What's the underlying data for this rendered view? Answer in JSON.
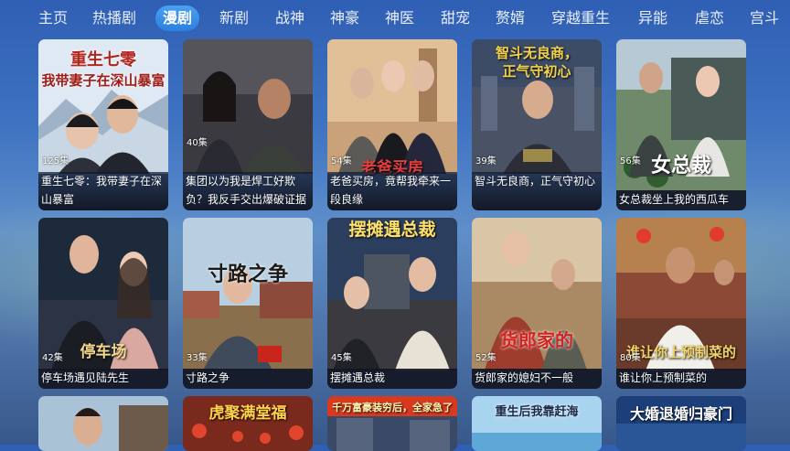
{
  "nav": {
    "tabs": [
      {
        "label": "主页",
        "active": false
      },
      {
        "label": "热播剧",
        "active": false
      },
      {
        "label": "漫剧",
        "active": true
      },
      {
        "label": "新剧",
        "active": false
      },
      {
        "label": "战神",
        "active": false
      },
      {
        "label": "神豪",
        "active": false
      },
      {
        "label": "神医",
        "active": false
      },
      {
        "label": "甜宠",
        "active": false
      },
      {
        "label": "赘婿",
        "active": false
      },
      {
        "label": "穿越重生",
        "active": false
      },
      {
        "label": "异能",
        "active": false
      },
      {
        "label": "虐恋",
        "active": false
      },
      {
        "label": "宫斗",
        "active": false
      }
    ]
  },
  "cards": [
    {
      "episodes": "125集",
      "title": "重生七零：我带妻子在深山暴富",
      "poster_text": "重生七零 我带妻子在深山暴富"
    },
    {
      "episodes": "40集",
      "title": "集团以为我是焊工好欺负？我反手交出爆破证据",
      "poster_text": "集团以为我是焊工好欺负?"
    },
    {
      "episodes": "54集",
      "title": "老爸买房，竟帮我牵来一段良缘",
      "poster_text": "老爸买房"
    },
    {
      "episodes": "39集",
      "title": "智斗无良商，正气守初心",
      "poster_text": "智斗无良商，正气守初心"
    },
    {
      "episodes": "56集",
      "title": "女总裁坐上我的西瓜车",
      "poster_text": "女总裁 坐上我的"
    },
    {
      "episodes": "42集",
      "title": "停车场遇见陆先生",
      "poster_text": "停车场 遇见陆先生"
    },
    {
      "episodes": "33集",
      "title": "寸路之争",
      "poster_text": "寸路之争"
    },
    {
      "episodes": "45集",
      "title": "摆摊遇总裁",
      "poster_text": "摆摊遇总裁"
    },
    {
      "episodes": "52集",
      "title": "货郎家的媳妇不一般",
      "poster_text": "货郎家的 媳妇不一般"
    },
    {
      "episodes": "80集",
      "title": "谁让你上预制菜的",
      "poster_text": "谁让你上预制菜的"
    },
    {
      "episodes": "",
      "title": "",
      "poster_text": ""
    },
    {
      "episodes": "",
      "title": "",
      "poster_text": "虎聚满堂福"
    },
    {
      "episodes": "",
      "title": "",
      "poster_text": "千万富豪装穷后，全家急了"
    },
    {
      "episodes": "",
      "title": "",
      "poster_text": "重生后我靠赶海 逆袭人生"
    },
    {
      "episodes": "",
      "title": "",
      "poster_text": "大婚退婚归豪门"
    }
  ],
  "colors": {
    "active_tab": "#3a92ea",
    "caption_bg": "#141a28"
  }
}
